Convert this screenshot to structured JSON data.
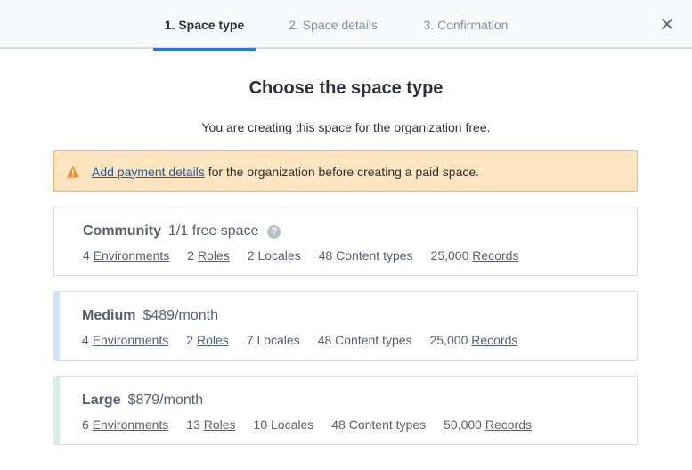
{
  "stepper": {
    "steps": [
      {
        "label": "1. Space type"
      },
      {
        "label": "2. Space details"
      },
      {
        "label": "3. Confirmation"
      }
    ]
  },
  "main": {
    "title": "Choose the space type",
    "subtitle": "You are creating this space for the organization free."
  },
  "warning": {
    "link": "Add payment details",
    "text": " for the organization before creating a paid space."
  },
  "plans": [
    {
      "name": "Community",
      "price": "1/1 free space",
      "environments_count": "4",
      "environments_label": "Environments",
      "roles_count": "2",
      "roles_label": "Roles",
      "locales": "2 Locales",
      "content_types": "48 Content types",
      "records_count": "25,000",
      "records_label": "Records"
    },
    {
      "name": "Medium",
      "price": "$489/month",
      "environments_count": "4",
      "environments_label": "Environments",
      "roles_count": "2",
      "roles_label": "Roles",
      "locales": "7 Locales",
      "content_types": "48 Content types",
      "records_count": "25,000",
      "records_label": "Records"
    },
    {
      "name": "Large",
      "price": "$879/month",
      "environments_count": "6",
      "environments_label": "Environments",
      "roles_count": "13",
      "roles_label": "Roles",
      "locales": "10 Locales",
      "content_types": "48 Content types",
      "records_count": "50,000",
      "records_label": "Records"
    }
  ],
  "help_glyph": "?",
  "colors": {
    "accent": "#2e75d4",
    "warning_bg": "#fde5c0",
    "warning_icon": "#f08c2f",
    "medium_stripe": "#d1e2f5",
    "large_stripe": "#d9efe3"
  }
}
